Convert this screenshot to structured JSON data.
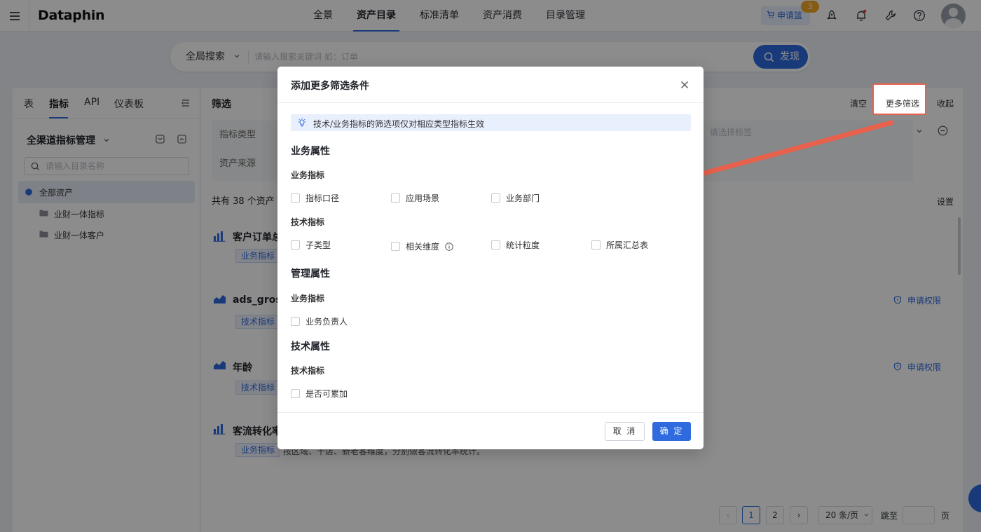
{
  "app": {
    "logo": "Dataphin"
  },
  "nav": {
    "items": [
      {
        "label": "全景"
      },
      {
        "label": "资产目录"
      },
      {
        "label": "标准清单"
      },
      {
        "label": "资产消费"
      },
      {
        "label": "目录管理"
      }
    ],
    "active_index": 1,
    "cart_label": "申请篮",
    "cart_count": "3",
    "icons": [
      "rocket-icon",
      "bell-icon",
      "wrench-icon",
      "help-icon"
    ]
  },
  "search": {
    "scope": "全局搜索",
    "placeholder": "请输入搜索关键词 如：订单",
    "button": "发现"
  },
  "left_panel": {
    "tabs": [
      "表",
      "指标",
      "API",
      "仪表板"
    ],
    "active_tab": 1,
    "catalog_title": "全渠道指标管理",
    "dir_search_placeholder": "请输入目录名称",
    "tree": [
      {
        "label": "全部资产"
      },
      {
        "label": "业财一体指标"
      },
      {
        "label": "业财一体客户"
      }
    ]
  },
  "main": {
    "filter_title": "筛选",
    "actions": {
      "clear": "清空",
      "more_filter": "更多筛选",
      "collapse": "收起"
    },
    "filters": [
      {
        "label": "指标类型"
      },
      {
        "label": "资产来源"
      }
    ],
    "tag_placeholder": "请选择标签",
    "total_count": "共有 38 个资产",
    "settings": "设置",
    "assets": [
      {
        "title": "客户订单总",
        "tag": "业务指标",
        "apply": ""
      },
      {
        "title": "ads_gross",
        "tag": "技术指标 -",
        "apply": "申请权限"
      },
      {
        "title": "年龄",
        "tag": "技术指标 -",
        "apply": "申请权限"
      },
      {
        "title": "客流转化率",
        "tag": "业务指标",
        "desc": "按区域、千店、新老客维度，分别做客流转化率统计。",
        "apply": ""
      }
    ],
    "pagination": {
      "pages": [
        "1",
        "2"
      ],
      "page_size": "20 条/页",
      "jump_label": "跳至",
      "page_unit": "页"
    }
  },
  "modal": {
    "title": "添加更多筛选条件",
    "tip": "技术/业务指标的筛选项仅对相应类型指标生效",
    "sections": [
      {
        "title": "业务属性",
        "groups": [
          {
            "title": "业务指标",
            "options": [
              "指标口径",
              "应用场景",
              "业务部门"
            ]
          },
          {
            "title": "技术指标",
            "options": [
              "子类型",
              "相关维度",
              "统计粒度",
              "所属汇总表"
            ]
          }
        ]
      },
      {
        "title": "管理属性",
        "groups": [
          {
            "title": "业务指标",
            "options": [
              "业务负责人"
            ]
          }
        ]
      },
      {
        "title": "技术属性",
        "groups": [
          {
            "title": "技术指标",
            "options": [
              "是否可累加"
            ]
          }
        ]
      }
    ],
    "cancel": "取 消",
    "ok": "确 定"
  },
  "colors": {
    "accent": "#2f6bde",
    "annotation": "#e8614d",
    "badge": "#f5a623"
  }
}
